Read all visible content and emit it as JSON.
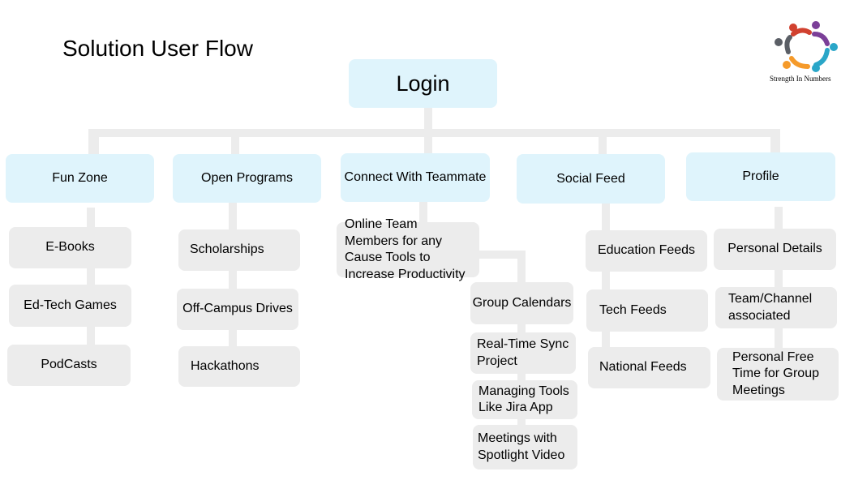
{
  "page_title": "Solution User Flow",
  "logo": {
    "caption": "Strength In Numbers",
    "name": "strength-in-numbers-logo-icon"
  },
  "root": {
    "label": "Login"
  },
  "colors": {
    "category_bg": "#dff4fc",
    "item_bg": "#ececec",
    "connector": "#ececec"
  },
  "categories": {
    "fun_zone": {
      "label": "Fun Zone",
      "items": [
        "E-Books",
        "Ed-Tech Games",
        "PodCasts"
      ]
    },
    "open_programs": {
      "label": "Open Programs",
      "items": [
        "Scholarships",
        "Off-Campus Drives",
        "Hackathons"
      ]
    },
    "connect": {
      "label": "Connect With Teammate",
      "main_item": "Online Team Members for any Cause Tools to Increase Productivity",
      "sub_items": [
        "Group Calendars",
        "Real-Time Sync Project",
        "Managing Tools Like Jira App",
        "Meetings with Spotlight Video"
      ]
    },
    "social_feed": {
      "label": "Social Feed",
      "items": [
        "Education Feeds",
        "Tech Feeds",
        "National Feeds"
      ]
    },
    "profile": {
      "label": "Profile",
      "items": [
        "Personal Details",
        "Team/Channel associated",
        "Personal Free Time for Group Meetings"
      ]
    }
  }
}
